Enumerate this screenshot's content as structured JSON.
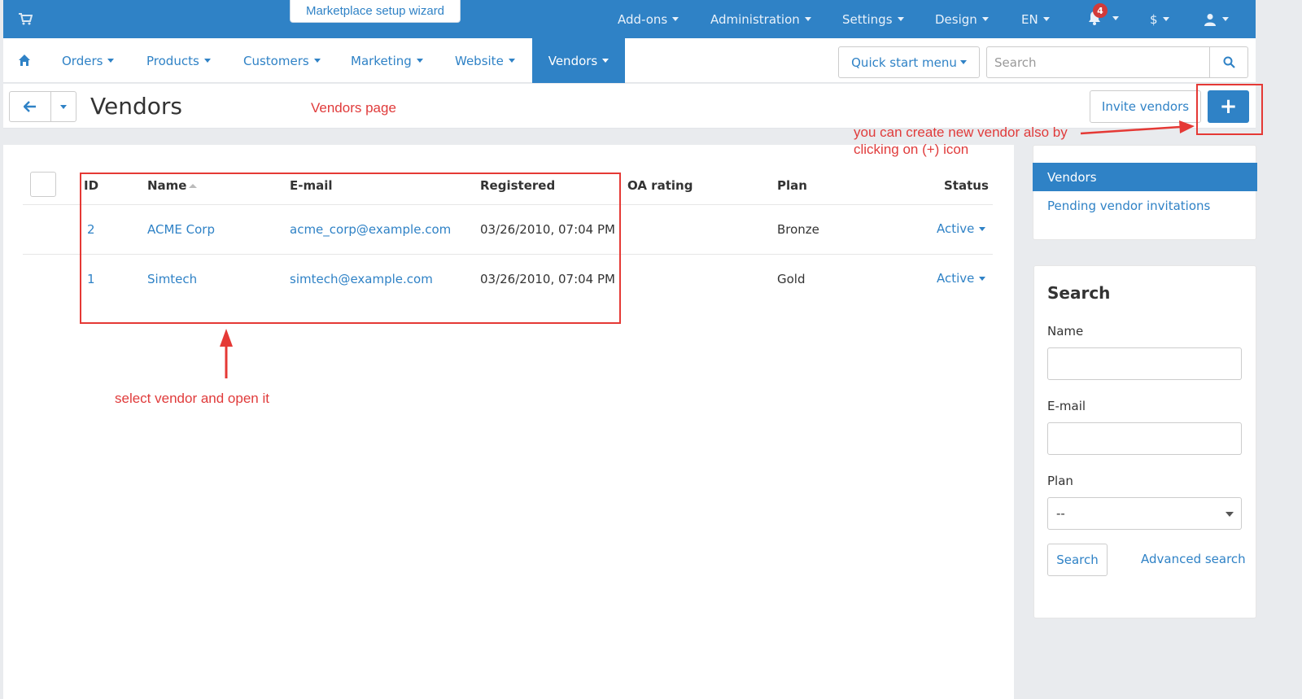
{
  "topbar": {
    "wizard_label": "Marketplace setup wizard",
    "menus": [
      {
        "label": "Add-ons"
      },
      {
        "label": "Administration"
      },
      {
        "label": "Settings"
      },
      {
        "label": "Design"
      },
      {
        "label": "EN"
      },
      {
        "label": "$"
      }
    ],
    "notifications_count": "4"
  },
  "nav": {
    "items": [
      {
        "label": "Orders"
      },
      {
        "label": "Products"
      },
      {
        "label": "Customers"
      },
      {
        "label": "Marketing"
      },
      {
        "label": "Website"
      },
      {
        "label": "Vendors"
      }
    ],
    "quick_start_label": "Quick start menu",
    "search_placeholder": "Search"
  },
  "page": {
    "title": "Vendors",
    "invite_label": "Invite vendors",
    "add_label": "+"
  },
  "table": {
    "headers": {
      "id": "ID",
      "name": "Name",
      "email": "E-mail",
      "registered": "Registered",
      "oa_rating": "OA rating",
      "plan": "Plan",
      "status": "Status"
    },
    "rows": [
      {
        "id": "2",
        "name": "ACME Corp",
        "email": "acme_corp@example.com",
        "registered": "03/26/2010, 07:04 PM",
        "plan": "Bronze",
        "status": "Active"
      },
      {
        "id": "1",
        "name": "Simtech",
        "email": "simtech@example.com",
        "registered": "03/26/2010, 07:04 PM",
        "plan": "Gold",
        "status": "Active"
      }
    ]
  },
  "sidebar": {
    "links": [
      {
        "label": "Vendors"
      },
      {
        "label": "Pending vendor invitations"
      }
    ],
    "search": {
      "title": "Search",
      "name_label": "Name",
      "email_label": "E-mail",
      "plan_label": "Plan",
      "plan_value": "--",
      "search_button": "Search",
      "advanced_link": "Advanced search"
    }
  },
  "annotations": {
    "vendors_page": "Vendors page",
    "create_vendor_line1": "you can create new vendor also by",
    "create_vendor_line2": "clicking on (+) icon",
    "select_vendor": "select vendor and open it"
  },
  "colors": {
    "brand": "#2f82c6",
    "annotation": "#e53935"
  }
}
